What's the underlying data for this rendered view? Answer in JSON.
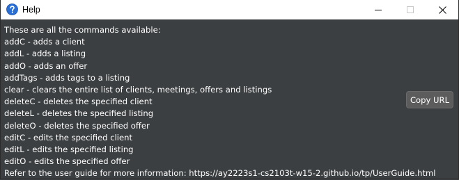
{
  "window": {
    "title": "Help",
    "title_icon": "help-question-icon",
    "controls": [
      "minimize-icon",
      "maximize-icon",
      "close-icon"
    ]
  },
  "help": {
    "lines": [
      "These are all the commands available:",
      "addC - adds a client",
      "addL - adds a listing",
      "addO - adds an offer",
      "addTags - adds tags to a listing",
      "clear - clears the entire list of clients, meetings, offers and listings",
      "deleteC - deletes the specified client",
      "deleteL - deletes the specified listing",
      "deleteO - deletes the specified offer",
      "editC - edits the specified client",
      "editL - edits the specified listing",
      "editO - edits the specified offer",
      "Refer to the user guide for more information: https://ay2223s1-cs2103t-w15-2.github.io/tp/UserGuide.html"
    ]
  },
  "actions": {
    "copy_url_label": "Copy URL"
  },
  "colors": {
    "background": "#3c3f41",
    "titlebar": "#ffffff",
    "text": "#ffffff",
    "button": "#5c5c5c",
    "icon_blue": "#2a6fd4"
  }
}
